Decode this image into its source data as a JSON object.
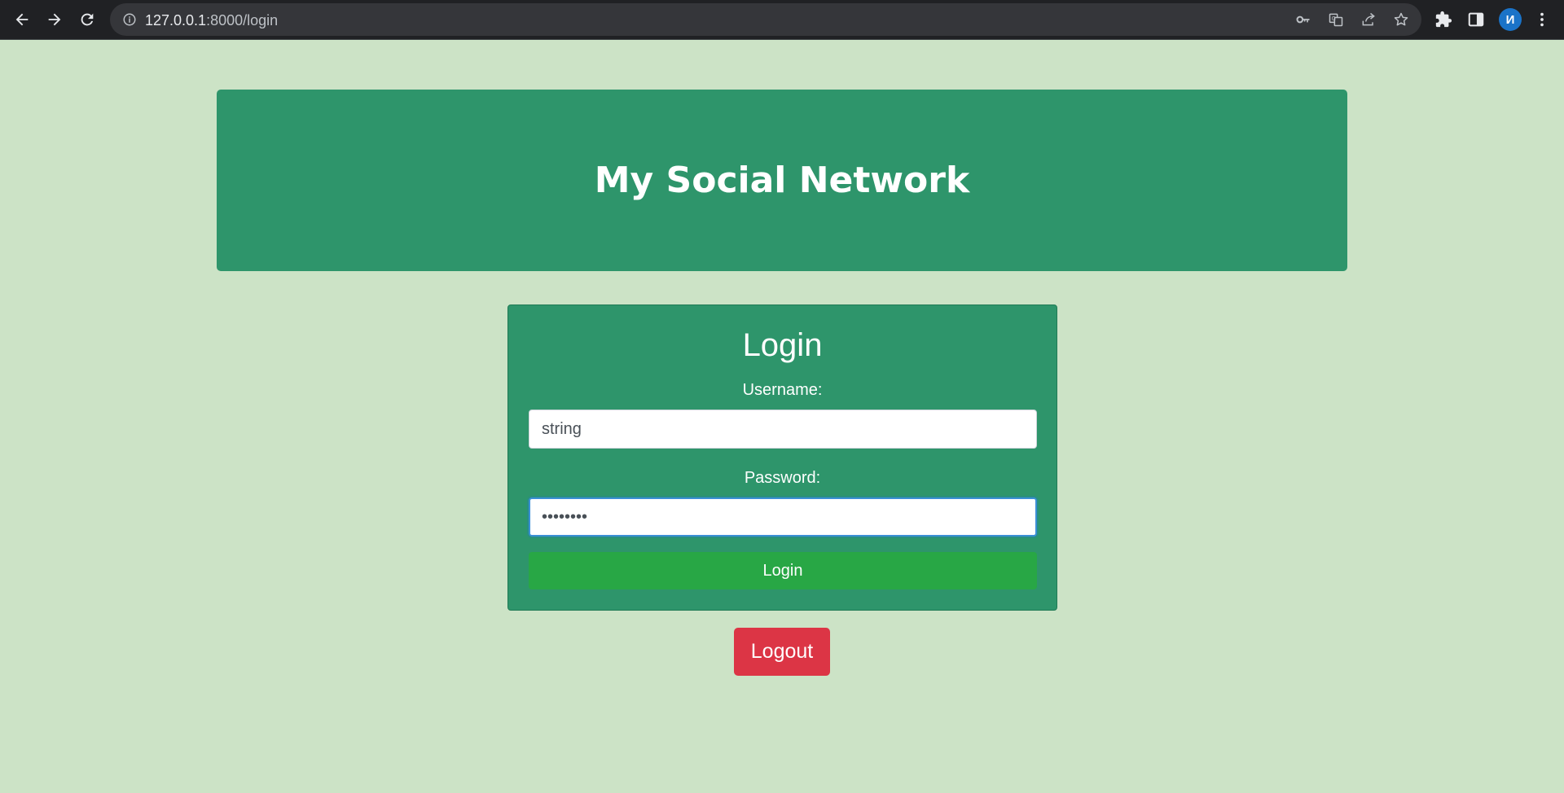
{
  "browser": {
    "url_host": "127.0.0.1",
    "url_path": ":8000/login",
    "nav_icons": [
      "back-arrow-icon",
      "forward-arrow-icon",
      "reload-icon"
    ],
    "omnibox_icons": [
      "info-icon",
      "key-icon",
      "translate-icon",
      "share-icon",
      "star-icon"
    ],
    "toolbar_icons": [
      "puzzle-icon",
      "side-panel-icon",
      "more-vert-icon"
    ],
    "avatar_letter": "И",
    "avatar_color": "#1a73c8"
  },
  "header": {
    "title": "My Social Network"
  },
  "login_form": {
    "heading": "Login",
    "username_label": "Username:",
    "username_value": "string",
    "password_label": "Password:",
    "password_value": "password",
    "submit_label": "Login"
  },
  "logout": {
    "label": "Logout"
  },
  "colors": {
    "page_background": "#cce3c6",
    "panel_green": "#2e956b",
    "login_button": "#28a745",
    "logout_button": "#dc3545"
  }
}
